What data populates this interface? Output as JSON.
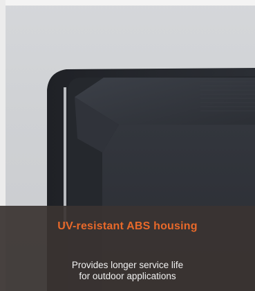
{
  "image": {
    "subject": "housing-photo",
    "colors": {
      "background": "#d0d2d5",
      "housing": "#2a2d33",
      "panel": "#3a3431",
      "accent": "#e8692a",
      "text": "#f2f2f2"
    }
  },
  "caption": {
    "title": "UV-resistant ABS housing",
    "line1": "Provides longer service life",
    "line2": "for outdoor applications"
  }
}
